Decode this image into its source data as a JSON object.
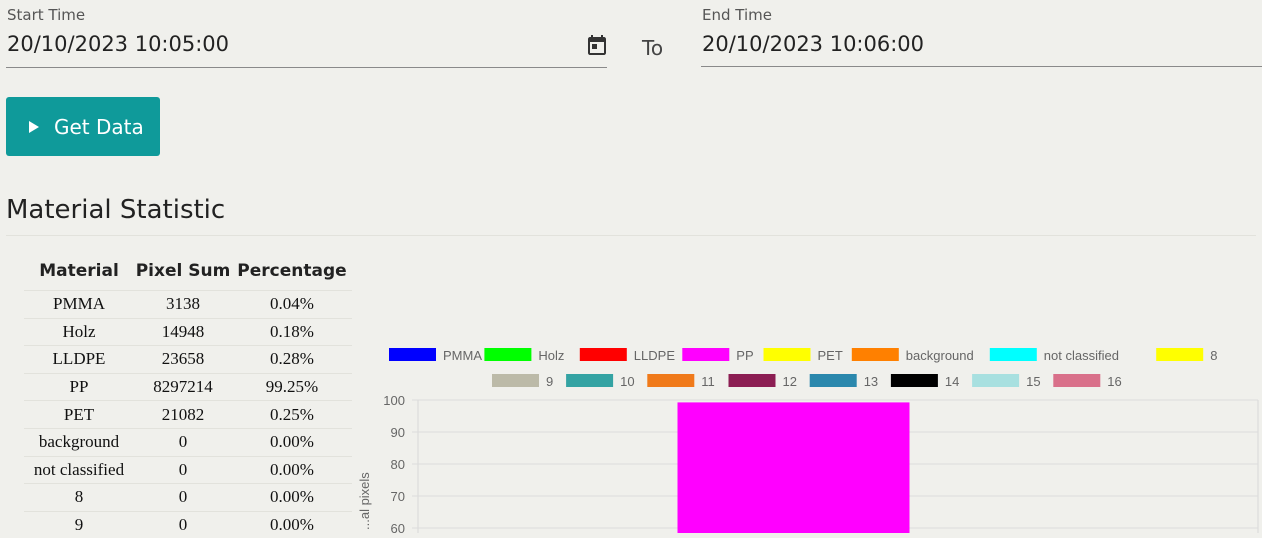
{
  "start": {
    "label": "Start Time",
    "value": "20/10/2023 10:05:00"
  },
  "to_label": "To",
  "end": {
    "label": "End Time",
    "value": "20/10/2023 10:06:00"
  },
  "get_data_label": "Get Data",
  "section_title": "Material Statistic",
  "table": {
    "headers": [
      "Material",
      "Pixel Sum",
      "Percentage"
    ],
    "rows": [
      [
        "PMMA",
        "3138",
        "0.04%"
      ],
      [
        "Holz",
        "14948",
        "0.18%"
      ],
      [
        "LLDPE",
        "23658",
        "0.28%"
      ],
      [
        "PP",
        "8297214",
        "99.25%"
      ],
      [
        "PET",
        "21082",
        "0.25%"
      ],
      [
        "background",
        "0",
        "0.00%"
      ],
      [
        "not classified",
        "0",
        "0.00%"
      ],
      [
        "8",
        "0",
        "0.00%"
      ],
      [
        "9",
        "0",
        "0.00%"
      ]
    ]
  },
  "chart_data": {
    "type": "bar",
    "ylabel": "...al pixels",
    "ylim": [
      0,
      100
    ],
    "yticks": [
      60,
      70,
      80,
      90,
      100
    ],
    "grid": true,
    "legend_position": "top",
    "series": [
      {
        "name": "PMMA",
        "color": "#0000ff",
        "value": 0.04
      },
      {
        "name": "Holz",
        "color": "#00ff00",
        "value": 0.18
      },
      {
        "name": "LLDPE",
        "color": "#ff0000",
        "value": 0.28
      },
      {
        "name": "PP",
        "color": "#ff00ff",
        "value": 99.25
      },
      {
        "name": "PET",
        "color": "#ffff00",
        "value": 0.25
      },
      {
        "name": "background",
        "color": "#ff8000",
        "value": 0
      },
      {
        "name": "not classified",
        "color": "#00ffff",
        "value": 0
      },
      {
        "name": "8",
        "color": "#ffff00",
        "value": 0
      },
      {
        "name": "9",
        "color": "#bcbaa8",
        "value": 0
      },
      {
        "name": "10",
        "color": "#34a3a3",
        "value": 0
      },
      {
        "name": "11",
        "color": "#f07a1a",
        "value": 0
      },
      {
        "name": "12",
        "color": "#8c1e53",
        "value": 0
      },
      {
        "name": "13",
        "color": "#2b88ad",
        "value": 0
      },
      {
        "name": "14",
        "color": "#000000",
        "value": 0
      },
      {
        "name": "15",
        "color": "#a8e0e0",
        "value": 0
      },
      {
        "name": "16",
        "color": "#d9708a",
        "value": 0
      }
    ]
  }
}
